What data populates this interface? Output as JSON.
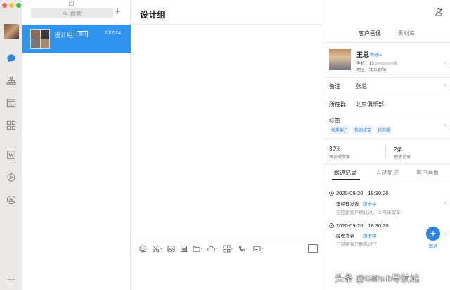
{
  "window": {
    "controls": [
      "close",
      "minimize",
      "maximize"
    ],
    "control_colors": [
      "#fe5f57",
      "#febc2e",
      "#28c840"
    ]
  },
  "rail": {
    "icons": [
      "chat-icon",
      "org-chart-icon",
      "calendar-icon",
      "apps-grid-icon",
      "document-icon",
      "hexagon-icon",
      "drive-icon",
      "menu-icon"
    ],
    "active_color": "#2f86e0"
  },
  "list": {
    "close_mark": "×",
    "search_placeholder": "搜索",
    "add_label": "+",
    "conversations": [
      {
        "name": "设计组",
        "tag": "部门",
        "date": "20/7/24",
        "selected": true
      }
    ]
  },
  "chat": {
    "title": "设计组",
    "toolbar": [
      "emoji-icon",
      "scissors-icon",
      "image-icon",
      "doc-icon",
      "folder-icon",
      "cloud-icon",
      "apps-icon",
      "phone-icon",
      "screen-icon"
    ]
  },
  "panel": {
    "tabs": [
      "客户画像",
      "素材库"
    ],
    "profile": {
      "name": "王总",
      "status": "跟进中",
      "phone_label": "手机：",
      "phone_value_visible": "13",
      "phone_value_tail": "9",
      "area_label": "地区：",
      "area_value": "北京朝阳"
    },
    "rows": [
      {
        "label": "备注",
        "value": "张总"
      },
      {
        "label": "所在群",
        "value": "北京俱乐部"
      }
    ],
    "tags_label": "标签",
    "tags": [
      "优质客户",
      "快速成交",
      "好沟通"
    ],
    "stats": [
      {
        "value": "30%",
        "label": "预计成交率"
      },
      {
        "value": "2条",
        "label": "跟进记录"
      }
    ],
    "follow_tabs": [
      "跟进记录",
      "互动轨迹",
      "客户画像"
    ],
    "records": [
      {
        "date": "2020-09-20",
        "time": "18:30:20",
        "who": "李经理发表",
        "status": "跟进中",
        "note": "已经跟客户确认过，20号来取车"
      },
      {
        "date": "2020-09-20",
        "time": "18:30:20",
        "who": "经理发表",
        "status": "跟进中",
        "note": "已经跟客户联系过了"
      }
    ],
    "fab_symbol": "+",
    "fab_label": "跟进"
  },
  "watermark": "头条 @Github导航站"
}
